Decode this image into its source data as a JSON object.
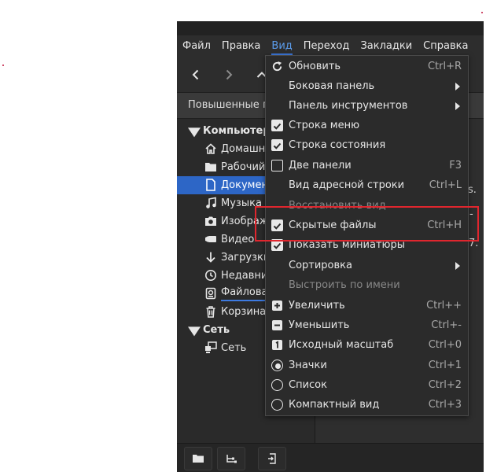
{
  "colors": {
    "accent": "#2d66c6",
    "highlight": "#e0262e",
    "menu_bg": "#2b2b2b"
  },
  "menubar": [
    {
      "label": "Файл"
    },
    {
      "label": "Правка"
    },
    {
      "label": "Вид"
    },
    {
      "label": "Переход"
    },
    {
      "label": "Закладки"
    },
    {
      "label": "Справка"
    }
  ],
  "location": {
    "text": "Повышенные пр"
  },
  "sidebar": {
    "computer_label": "Компьютер",
    "network_label": "Сеть",
    "items": [
      {
        "label": "Домашня",
        "icon": "home-icon"
      },
      {
        "label": "Рабочий",
        "icon": "folder-icon"
      },
      {
        "label": "Документ",
        "icon": "document-icon"
      },
      {
        "label": "Музыка",
        "icon": "music-icon"
      },
      {
        "label": "Изображе",
        "icon": "camera-icon"
      },
      {
        "label": "Видео",
        "icon": "video-icon"
      },
      {
        "label": "Загрузки",
        "icon": "download-icon"
      },
      {
        "label": "Недавние",
        "icon": "clock-icon"
      },
      {
        "label": "Файловая",
        "icon": "drive-icon"
      },
      {
        "label": "Корзина",
        "icon": "trash-icon"
      }
    ],
    "network_items": [
      {
        "label": "Сеть",
        "icon": "network-icon"
      }
    ]
  },
  "rightpane": {
    "frag1": "s.",
    "frag2": "-",
    "frag3": "7."
  },
  "view_menu": {
    "items": [
      {
        "label": "Обновить",
        "shortcut": "Ctrl+R",
        "icon": "refresh-icon"
      },
      {
        "label": "Боковая панель",
        "shortcut": "",
        "submenu": true
      },
      {
        "label": "Панель инструментов",
        "shortcut": "",
        "submenu": true
      },
      {
        "label": "Строка меню",
        "shortcut": "",
        "check": "on"
      },
      {
        "label": "Строка состояния",
        "shortcut": "",
        "check": "on"
      },
      {
        "label": "Две панели",
        "shortcut": "F3",
        "check": "off"
      },
      {
        "label": "Вид адресной строки",
        "shortcut": "Ctrl+L"
      },
      {
        "label": "Восстановить вид",
        "shortcut": "",
        "disabled": true
      },
      {
        "label": "Скрытые файлы",
        "shortcut": "Ctrl+H",
        "check": "on"
      },
      {
        "label": "Показать миниатюры",
        "shortcut": "",
        "check": "on"
      },
      {
        "label": "Сортировка",
        "shortcut": "",
        "submenu": true
      },
      {
        "label": "Выстроить по имени",
        "shortcut": "",
        "disabled": true
      },
      {
        "label": "Увеличить",
        "shortcut": "Ctrl++",
        "icon": "zoom-in-icon"
      },
      {
        "label": "Уменьшить",
        "shortcut": "Ctrl+-",
        "icon": "zoom-out-icon"
      },
      {
        "label": "Исходный масштаб",
        "shortcut": "Ctrl+0",
        "icon": "zoom-original-icon"
      },
      {
        "label": "Значки",
        "shortcut": "Ctrl+1",
        "radio": "on"
      },
      {
        "label": "Список",
        "shortcut": "Ctrl+2",
        "radio": "off"
      },
      {
        "label": "Компактный вид",
        "shortcut": "Ctrl+3",
        "radio": "off"
      }
    ]
  }
}
